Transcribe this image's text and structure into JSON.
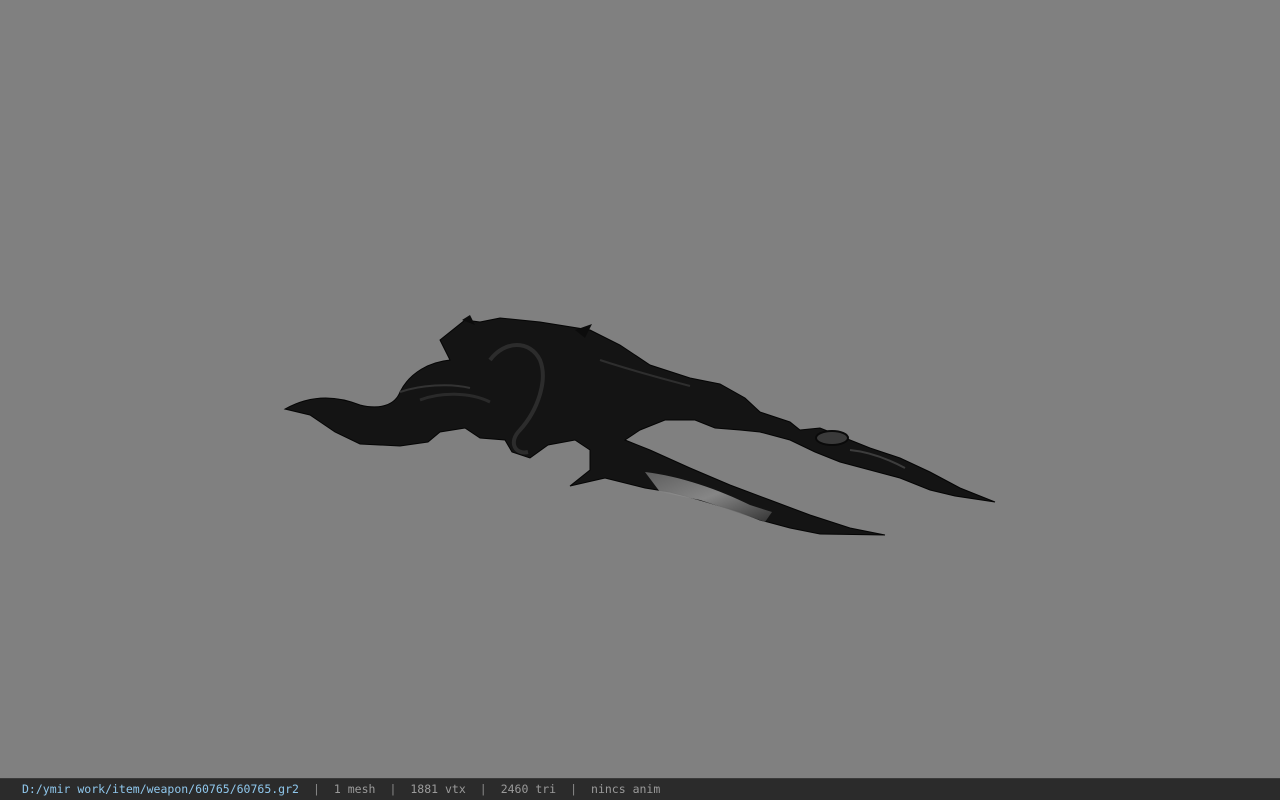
{
  "viewport": {
    "background": "#808080",
    "model_description": "dark ornate blade weapon mesh"
  },
  "status": {
    "path": "D:/ymir work/item/weapon/60765/60765.gr2",
    "mesh": "1 mesh",
    "vtx": "1881 vtx",
    "tri": "2460 tri",
    "anim": "nincs anim",
    "separator": "|"
  },
  "colors": {
    "path_text": "#8fc7ec",
    "status_text": "#9a9a9a",
    "status_bg": "#2b2b2b"
  }
}
